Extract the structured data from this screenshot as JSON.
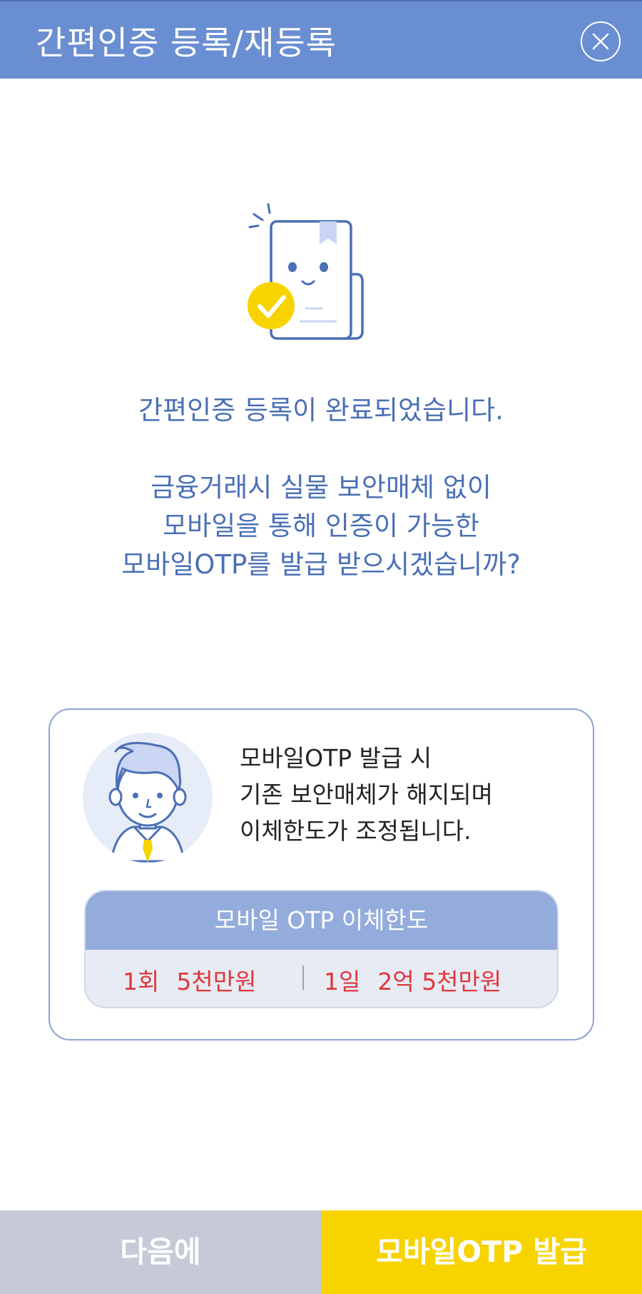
{
  "header": {
    "title": "간편인증 등록/재등록",
    "close_icon": "close-icon"
  },
  "main": {
    "illustration_icon": "document-check-icon",
    "message_line1": "간편인증 등록이 완료되었습니다.",
    "message_line2": "금융거래시 실물 보안매체 없이",
    "message_line3": "모바일을 통해 인증이 가능한",
    "message_line4": "모바일OTP를 발급 받으시겠습니까?"
  },
  "info_card": {
    "avatar_icon": "businessman-avatar-icon",
    "line1": "모바일OTP 발급 시",
    "line2": "기존 보안매체가 해지되며",
    "line3": "이체한도가 조정됩니다.",
    "limit_title": "모바일 OTP 이체한도",
    "per_time_label": "1회",
    "per_time_value": "5천만원",
    "per_day_label": "1일",
    "per_day_value": "2억 5천만원"
  },
  "buttons": {
    "later_label": "다음에",
    "issue_label": "모바일OTP 발급"
  },
  "colors": {
    "header": "#6a8ed2",
    "message_text": "#4a6fb5",
    "limit_value": "#e0373c",
    "later_button": "#c5cad6",
    "issue_button": "#f7d300"
  }
}
